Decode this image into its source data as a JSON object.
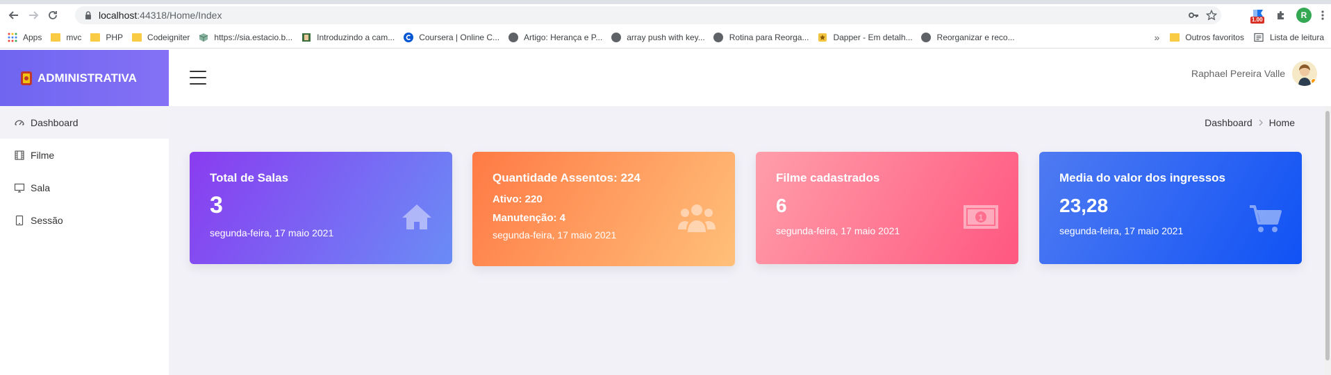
{
  "browser": {
    "url_host": "localhost",
    "url_rest": ":44318/Home/Index",
    "profile_initial": "R",
    "ext_badge": "1.00"
  },
  "bookmarks": {
    "items": [
      {
        "label": "Apps",
        "icon": "apps-grid-icon"
      },
      {
        "label": "mvc",
        "icon": "folder-icon"
      },
      {
        "label": "PHP",
        "icon": "folder-icon"
      },
      {
        "label": "Codeigniter",
        "icon": "folder-icon"
      },
      {
        "label": "https://sia.estacio.b...",
        "icon": "cube-icon"
      },
      {
        "label": "Introduzindo a cam...",
        "icon": "page-icon"
      },
      {
        "label": "Coursera | Online C...",
        "icon": "coursera-icon"
      },
      {
        "label": "Artigo: Herança e P...",
        "icon": "globe-icon"
      },
      {
        "label": "array push with key...",
        "icon": "globe-icon"
      },
      {
        "label": "Rotina para Reorga...",
        "icon": "globe-icon"
      },
      {
        "label": "Dapper - Em detalh...",
        "icon": "star-badge-icon"
      },
      {
        "label": "Reorganizar e reco...",
        "icon": "globe-icon"
      }
    ],
    "more": "»",
    "other_favorites": "Outros favoritos",
    "reading_list": "Lista de leitura"
  },
  "sidebar": {
    "brand": "ADMINISTRATIVA",
    "items": [
      {
        "label": "Dashboard",
        "icon": "speedometer-icon"
      },
      {
        "label": "Filme",
        "icon": "film-icon"
      },
      {
        "label": "Sala",
        "icon": "monitor-icon"
      },
      {
        "label": "Sessão",
        "icon": "tablet-icon"
      }
    ]
  },
  "header": {
    "user_name": "Raphael Pereira Valle"
  },
  "breadcrumb": {
    "items": [
      "Dashboard",
      "Home"
    ]
  },
  "cards": [
    {
      "title": "Total de Salas",
      "value": "3",
      "date": "segunda-feira, 17 maio 2021",
      "icon": "home-icon"
    },
    {
      "title": "Quantidade Assentos: 224",
      "line1": "Ativo: 220",
      "line2": "Manutenção: 4",
      "date": "segunda-feira, 17 maio 2021",
      "icon": "users-icon"
    },
    {
      "title": "Filme cadastrados",
      "value": "6",
      "date": "segunda-feira, 17 maio 2021",
      "icon": "money-bill-icon"
    },
    {
      "title": "Media do valor dos ingressos",
      "value": "23,28",
      "date": "segunda-feira, 17 maio 2021",
      "icon": "shopping-cart-icon"
    }
  ]
}
